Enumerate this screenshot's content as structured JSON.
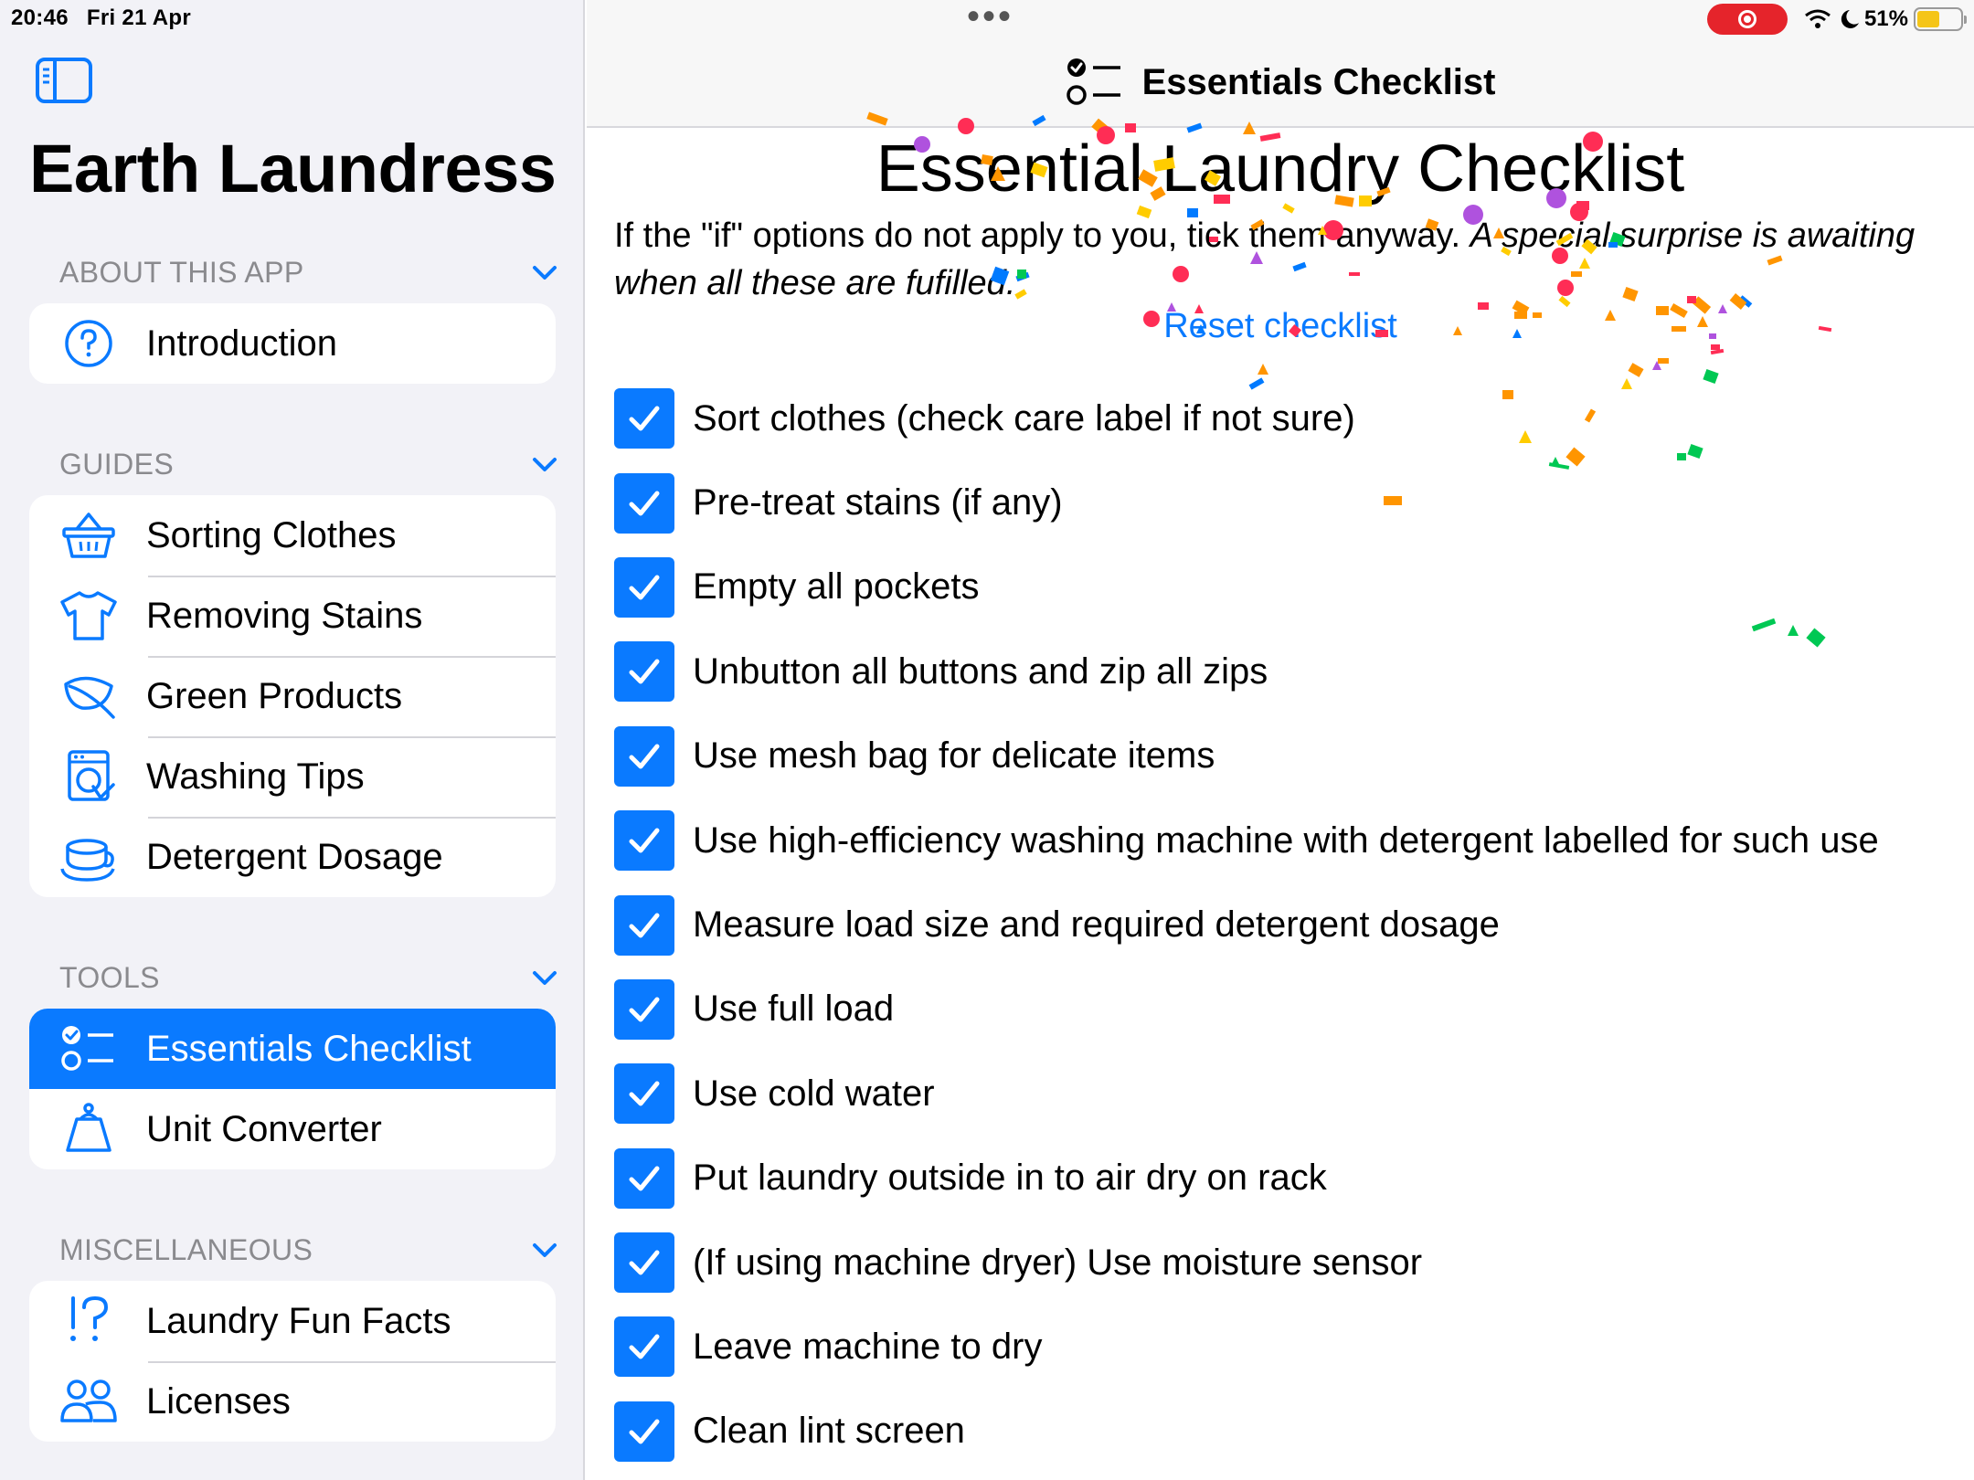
{
  "status": {
    "time": "20:46",
    "date": "Fri 21 Apr",
    "battery": "51%"
  },
  "sidebar": {
    "app_title": "Earth Laundress",
    "sections": [
      {
        "title": "ABOUT THIS APP",
        "items": [
          {
            "label": "Introduction",
            "icon": "question-circle-icon"
          }
        ]
      },
      {
        "title": "GUIDES",
        "items": [
          {
            "label": "Sorting Clothes",
            "icon": "basket-icon"
          },
          {
            "label": "Removing Stains",
            "icon": "tshirt-icon"
          },
          {
            "label": "Green Products",
            "icon": "leaf-icon"
          },
          {
            "label": "Washing Tips",
            "icon": "washing-machine-icon"
          },
          {
            "label": "Detergent Dosage",
            "icon": "cup-icon"
          }
        ]
      },
      {
        "title": "TOOLS",
        "items": [
          {
            "label": "Essentials Checklist",
            "icon": "checklist-icon",
            "selected": true
          },
          {
            "label": "Unit Converter",
            "icon": "scale-icon"
          }
        ]
      },
      {
        "title": "MISCELLANEOUS",
        "items": [
          {
            "label": "Laundry Fun Facts",
            "icon": "exclaim-question-icon"
          },
          {
            "label": "Licenses",
            "icon": "people-icon"
          }
        ]
      }
    ]
  },
  "navbar": {
    "title": "Essentials Checklist"
  },
  "main": {
    "title": "Essential Laundry Checklist",
    "intro_plain": "If the \"if\" options do not apply to you, tick them anyway. ",
    "intro_italic": "A special surprise is awaiting when all these are fufilled.",
    "reset_label": "Reset checklist",
    "items": [
      "Sort clothes (check care label if not sure)",
      "Pre-treat stains (if any)",
      "Empty all pockets",
      "Unbutton all buttons and zip all zips",
      "Use mesh bag for delicate items",
      "Use high-efficiency washing machine with detergent labelled for such use",
      "Measure load size and required detergent dosage",
      "Use full load",
      "Use cold water",
      "Put laundry outside in to air dry on rack",
      "(If using machine dryer) Use moisture sensor",
      "Leave machine to dry",
      "Clean lint screen"
    ],
    "all_checked": true
  },
  "colors": {
    "accent": "#0a7aff",
    "sidebar_bg": "#f2f2f7",
    "record": "#e5242b"
  }
}
